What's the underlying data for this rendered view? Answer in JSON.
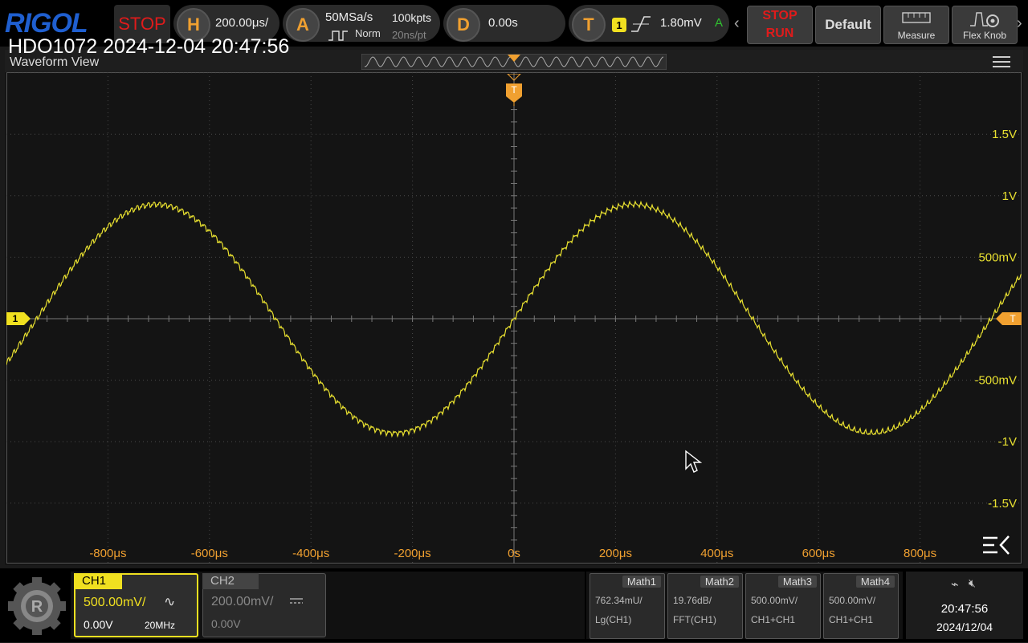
{
  "top": {
    "logo": "RIGOL",
    "status": "STOP",
    "horizontal": {
      "letter": "H",
      "value": "200.00μs/"
    },
    "acquire": {
      "letter": "A",
      "rate": "50MSa/s",
      "points": "100kpts",
      "mode": "Norm",
      "interval": "20ns/pt"
    },
    "delay": {
      "letter": "D",
      "value": "0.00s"
    },
    "trigger": {
      "letter": "T",
      "channel": "1",
      "level": "1.80mV",
      "mode": "A"
    },
    "run_stop": {
      "stop": "STOP",
      "run": "RUN"
    },
    "default_label": "Default",
    "measure_label": "Measure",
    "flexknob_label": "Flex Knob"
  },
  "overlay_title": "HDO1072 2024-12-04 20:47:56",
  "waveform_view_label": "Waveform View",
  "plot": {
    "x_ticks": [
      "-800μs",
      "-600μs",
      "-400μs",
      "-200μs",
      "0s",
      "200μs",
      "400μs",
      "600μs",
      "800μs"
    ],
    "y_ticks": [
      "1.5V",
      "1V",
      "500mV",
      "-500mV",
      "-1V",
      "-1.5V"
    ],
    "ch_marker": "1",
    "trig_marker": "T",
    "trace_color": "#e8e030",
    "amplitude_v": 0.93,
    "period_us": 940
  },
  "channels": [
    {
      "name": "CH1",
      "scale": "500.00mV/",
      "coupling_icon": "ac-icon",
      "offset": "0.00V",
      "bw": "20MHz",
      "color": "#f0e020",
      "active": true
    },
    {
      "name": "CH2",
      "scale": "200.00mV/",
      "coupling_icon": "dc-icon",
      "offset": "0.00V",
      "bw": "",
      "color": "#888888",
      "active": false
    }
  ],
  "math": [
    {
      "name": "Math1",
      "line1": "762.34mU/",
      "line2": "Lg(CH1)"
    },
    {
      "name": "Math2",
      "line1": "19.76dB/",
      "line2": "FFT(CH1)"
    },
    {
      "name": "Math3",
      "line1": "500.00mV/",
      "line2": "CH1+CH1"
    },
    {
      "name": "Math4",
      "line1": "500.00mV/",
      "line2": "CH1+CH1"
    }
  ],
  "clock": {
    "time": "20:47:56",
    "date": "2024/12/04"
  }
}
